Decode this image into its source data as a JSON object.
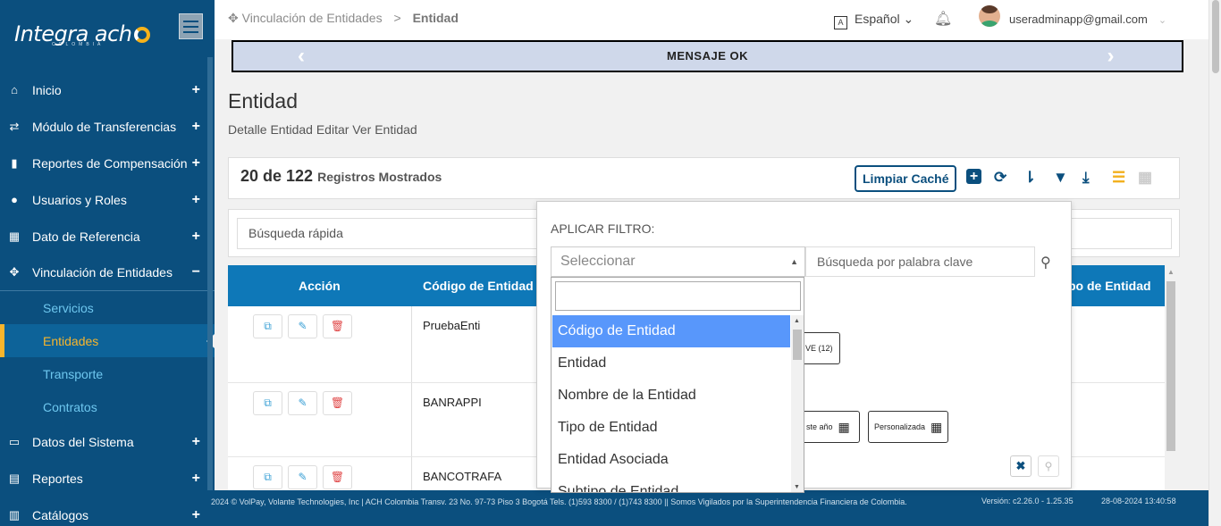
{
  "brand": {
    "logo_text": "Integra ach",
    "logo_sub": "COLOMBIA"
  },
  "sidebar": {
    "items": [
      {
        "label": "Inicio",
        "icon": "home-icon",
        "toggle": "+"
      },
      {
        "label": "Módulo de Transferencias",
        "icon": "transfer-icon",
        "toggle": "+"
      },
      {
        "label": "Reportes de Compensación",
        "icon": "file-icon",
        "toggle": "+"
      },
      {
        "label": "Usuarios y Roles",
        "icon": "users-icon",
        "toggle": "+"
      },
      {
        "label": "Dato de Referencia",
        "icon": "calendar-icon",
        "toggle": "+"
      },
      {
        "label": "Vinculación de Entidades",
        "icon": "link-icon",
        "toggle": "−"
      },
      {
        "label": "Datos del Sistema",
        "icon": "monitor-icon",
        "toggle": "+"
      },
      {
        "label": "Reportes",
        "icon": "report-icon",
        "toggle": "+"
      },
      {
        "label": "Catálogos",
        "icon": "catalog-icon",
        "toggle": "+"
      }
    ],
    "sub_items": [
      {
        "label": "Servicios"
      },
      {
        "label": "Entidades",
        "active": true
      },
      {
        "label": "Transporte"
      },
      {
        "label": "Contratos"
      }
    ]
  },
  "header": {
    "breadcrumb_root": "Vinculación de Entidades",
    "breadcrumb_sep": ">",
    "breadcrumb_current": "Entidad",
    "language": "Español",
    "user_email": "useradminapp@gmail.com"
  },
  "banner": {
    "message": "MENSAJE OK"
  },
  "page": {
    "title": "Entidad",
    "subtitle": "Detalle Entidad Editar Ver Entidad"
  },
  "toolbar": {
    "count": "20 de 122",
    "count_suffix": "Registros Mostrados",
    "clear_cache": "Limpiar Caché"
  },
  "search": {
    "quick_placeholder": "Búsqueda rápida"
  },
  "table": {
    "columns": [
      "Acción",
      "Código de Entidad",
      "po de Entidad"
    ],
    "rows": [
      {
        "code": "PruebaEnti"
      },
      {
        "code": "BANRAPPI"
      },
      {
        "code": "BANCOTRAFA"
      }
    ]
  },
  "filter": {
    "label": "APLICAR FILTRO:",
    "select_placeholder": "Seleccionar",
    "keyword_placeholder": "Búsqueda por palabra clave",
    "options": [
      "Código de Entidad",
      "Entidad",
      "Nombre de la Entidad",
      "Tipo de Entidad",
      "Entidad Asociada",
      "Subtipo de Entidad"
    ],
    "chips": {
      "ve": "VE (12)",
      "this_year": "ste año",
      "custom": "Personalizada"
    }
  },
  "footer": {
    "text": "2024 © VolPay, Volante Technologies, Inc | ACH Colombia Transv. 23 No. 97-73 Piso 3 Bogotá Tels. (1)593 8300 / (1)743 8300 || Somos Vigilados por la Superintendencia Financiera de Colombia.",
    "version": "Versión: c2.26.0 - 1.25.35",
    "datetime": "28-08-2024 13:40:58"
  },
  "colors": {
    "sidebar": "#0b4f7e",
    "accent": "#f7b52c",
    "table_header": "#0e78b8",
    "selected_option": "#5897fb"
  }
}
